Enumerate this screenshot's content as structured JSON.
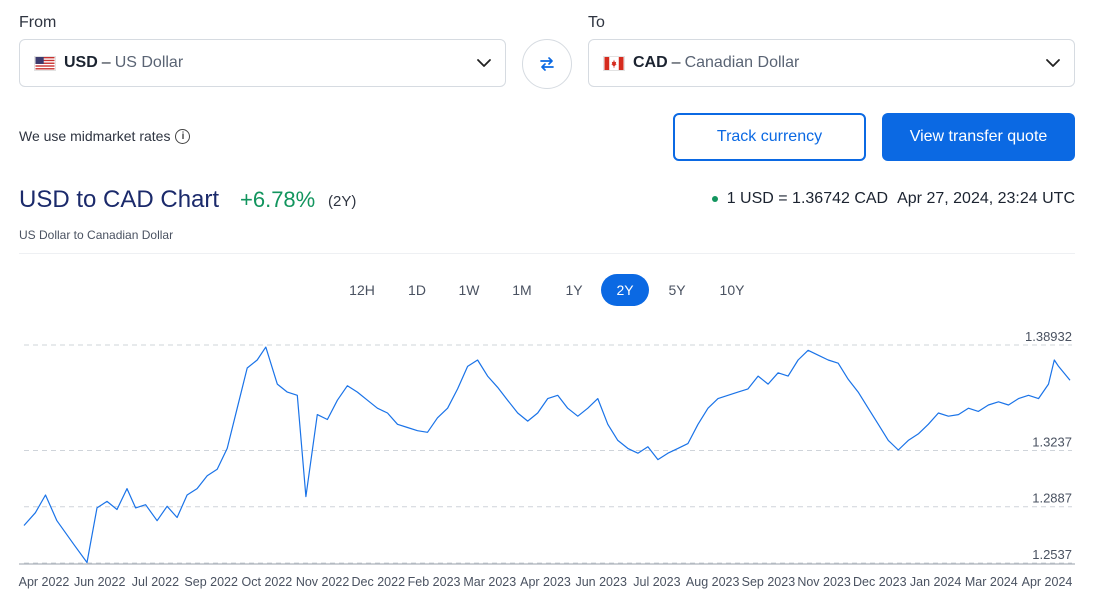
{
  "from": {
    "label": "From",
    "code": "USD",
    "dash": "–",
    "name": "US Dollar"
  },
  "to": {
    "label": "To",
    "code": "CAD",
    "dash": "–",
    "name": "Canadian Dollar"
  },
  "midmarket_text": "We use midmarket rates",
  "info_glyph": "i",
  "buttons": {
    "track": "Track currency",
    "quote": "View transfer quote"
  },
  "header": {
    "title": "USD to CAD Chart",
    "change": "+6.78%",
    "period": "(2Y)",
    "subtitle": "US Dollar to Canadian Dollar",
    "rate": "1 USD = 1.36742 CAD",
    "timestamp": "Apr 27, 2024, 23:24 UTC"
  },
  "ranges": [
    "12H",
    "1D",
    "1W",
    "1M",
    "1Y",
    "2Y",
    "5Y",
    "10Y"
  ],
  "active_range": "2Y",
  "colors": {
    "accent": "#0b69e3",
    "positive": "#12955e",
    "line": "#1a73e8"
  },
  "chart_data": {
    "type": "line",
    "title": "USD to CAD Chart",
    "ylim": [
      1.2537,
      1.38932
    ],
    "y_ticks": [
      "1.38932",
      "1.3237",
      "1.2887",
      "1.2537"
    ],
    "x_tick_labels": [
      "Apr 2022",
      "Jun 2022",
      "Jul 2022",
      "Sep 2022",
      "Oct 2022",
      "Nov 2022",
      "Dec 2022",
      "Feb 2023",
      "Mar 2023",
      "Apr 2023",
      "Jun 2023",
      "Jul 2023",
      "Aug 2023",
      "Sep 2023",
      "Nov 2023",
      "Dec 2023",
      "Jan 2024",
      "Mar 2024",
      "Apr 2024"
    ],
    "grid": "horizontal dashed",
    "series": [
      {
        "x": [
          "2022-04-27",
          "2022-05-05",
          "2022-05-12",
          "2022-05-20",
          "2022-06-01",
          "2022-06-10",
          "2022-06-17",
          "2022-06-24",
          "2022-07-01",
          "2022-07-08",
          "2022-07-14",
          "2022-07-21",
          "2022-07-29",
          "2022-08-05",
          "2022-08-12",
          "2022-08-19",
          "2022-08-26",
          "2022-09-02",
          "2022-09-09",
          "2022-09-16",
          "2022-09-23",
          "2022-09-30",
          "2022-10-07",
          "2022-10-13",
          "2022-10-21",
          "2022-10-28",
          "2022-11-04",
          "2022-11-10",
          "2022-11-18",
          "2022-11-25",
          "2022-12-02",
          "2022-12-09",
          "2022-12-16",
          "2022-12-23",
          "2022-12-30",
          "2023-01-06",
          "2023-01-13",
          "2023-01-20",
          "2023-01-27",
          "2023-02-03",
          "2023-02-10",
          "2023-02-17",
          "2023-02-24",
          "2023-03-03",
          "2023-03-10",
          "2023-03-17",
          "2023-03-24",
          "2023-03-31",
          "2023-04-07",
          "2023-04-14",
          "2023-04-21",
          "2023-04-28",
          "2023-05-05",
          "2023-05-12",
          "2023-05-19",
          "2023-05-26",
          "2023-06-02",
          "2023-06-09",
          "2023-06-16",
          "2023-06-23",
          "2023-06-30",
          "2023-07-07",
          "2023-07-14",
          "2023-07-21",
          "2023-07-28",
          "2023-08-04",
          "2023-08-11",
          "2023-08-18",
          "2023-08-25",
          "2023-09-01",
          "2023-09-08",
          "2023-09-15",
          "2023-09-22",
          "2023-09-29",
          "2023-10-06",
          "2023-10-13",
          "2023-10-20",
          "2023-10-27",
          "2023-11-03",
          "2023-11-10",
          "2023-11-17",
          "2023-11-24",
          "2023-12-01",
          "2023-12-08",
          "2023-12-15",
          "2023-12-22",
          "2023-12-29",
          "2024-01-05",
          "2024-01-12",
          "2024-01-19",
          "2024-01-26",
          "2024-02-02",
          "2024-02-09",
          "2024-02-16",
          "2024-02-23",
          "2024-03-01",
          "2024-03-08",
          "2024-03-15",
          "2024-03-22",
          "2024-03-29",
          "2024-04-05",
          "2024-04-12",
          "2024-04-16",
          "2024-04-19",
          "2024-04-27"
        ],
        "y": [
          1.277,
          1.285,
          1.296,
          1.28,
          1.265,
          1.254,
          1.288,
          1.292,
          1.287,
          1.3,
          1.288,
          1.29,
          1.28,
          1.289,
          1.282,
          1.296,
          1.3,
          1.308,
          1.312,
          1.325,
          1.35,
          1.375,
          1.38,
          1.388,
          1.365,
          1.36,
          1.358,
          1.295,
          1.346,
          1.343,
          1.355,
          1.364,
          1.36,
          1.355,
          1.35,
          1.347,
          1.34,
          1.338,
          1.336,
          1.335,
          1.344,
          1.35,
          1.362,
          1.376,
          1.38,
          1.37,
          1.363,
          1.355,
          1.347,
          1.342,
          1.347,
          1.356,
          1.358,
          1.35,
          1.345,
          1.35,
          1.356,
          1.34,
          1.33,
          1.325,
          1.322,
          1.326,
          1.318,
          1.322,
          1.325,
          1.328,
          1.34,
          1.35,
          1.356,
          1.358,
          1.36,
          1.362,
          1.37,
          1.365,
          1.372,
          1.37,
          1.38,
          1.386,
          1.383,
          1.38,
          1.378,
          1.368,
          1.36,
          1.35,
          1.34,
          1.33,
          1.324,
          1.33,
          1.334,
          1.34,
          1.347,
          1.345,
          1.346,
          1.35,
          1.348,
          1.352,
          1.354,
          1.352,
          1.356,
          1.358,
          1.356,
          1.365,
          1.38,
          1.376,
          1.3674
        ]
      }
    ]
  }
}
